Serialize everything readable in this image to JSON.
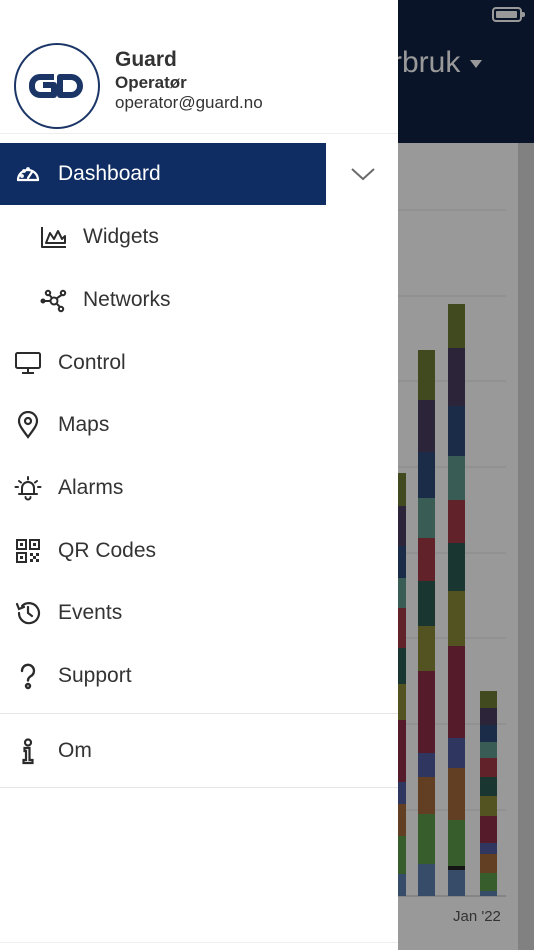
{
  "background": {
    "header_title": "rbruk",
    "chart_axis_label": "Jan '22"
  },
  "profile": {
    "logo_text": "GD",
    "name": "Guard",
    "role": "Operatør",
    "email": "operator@guard.no"
  },
  "nav": {
    "dashboard": {
      "label": "Dashboard",
      "icon": "speedometer-icon"
    },
    "widgets": {
      "label": "Widgets",
      "icon": "area-chart-icon"
    },
    "networks": {
      "label": "Networks",
      "icon": "network-graph-icon"
    },
    "control": {
      "label": "Control",
      "icon": "monitor-icon"
    },
    "maps": {
      "label": "Maps",
      "icon": "map-pin-icon"
    },
    "alarms": {
      "label": "Alarms",
      "icon": "alarm-bell-icon"
    },
    "qrcodes": {
      "label": "QR Codes",
      "icon": "qr-code-icon"
    },
    "events": {
      "label": "Events",
      "icon": "history-icon"
    },
    "support": {
      "label": "Support",
      "icon": "question-icon"
    },
    "om": {
      "label": "Om",
      "icon": "info-icon"
    }
  },
  "colors": {
    "header_navy": "#0f2244",
    "active_item": "#0f2c63",
    "logo_border": "#1a3566"
  }
}
